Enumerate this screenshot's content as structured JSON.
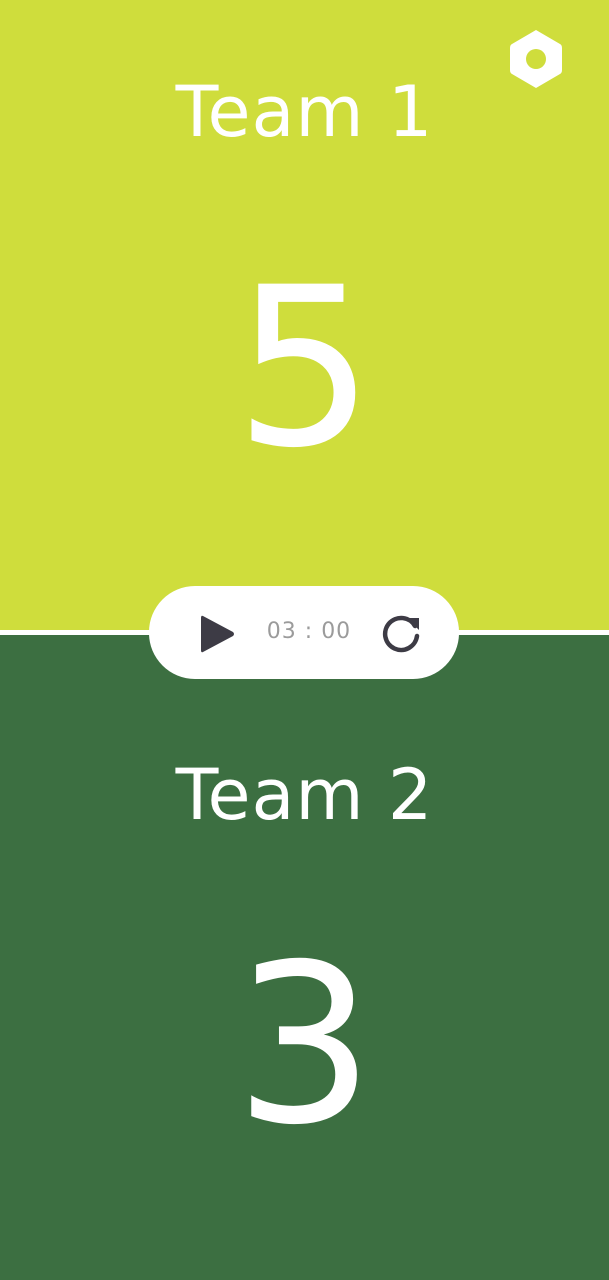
{
  "teams": [
    {
      "name": "Team 1",
      "score": "5",
      "color": "#cfdd3c"
    },
    {
      "name": "Team 2",
      "score": "3",
      "color": "#3c6f41"
    }
  ],
  "timer": {
    "display": "03 : 00",
    "play_icon": "play-icon",
    "reset_icon": "reset-icon"
  },
  "settings": {
    "icon": "settings-hexagon-icon"
  },
  "colors": {
    "divider": "#ffffff",
    "timer_bar": "#ffffff",
    "icon_dark": "#3d3b45",
    "timer_text": "#9b9b9b"
  }
}
